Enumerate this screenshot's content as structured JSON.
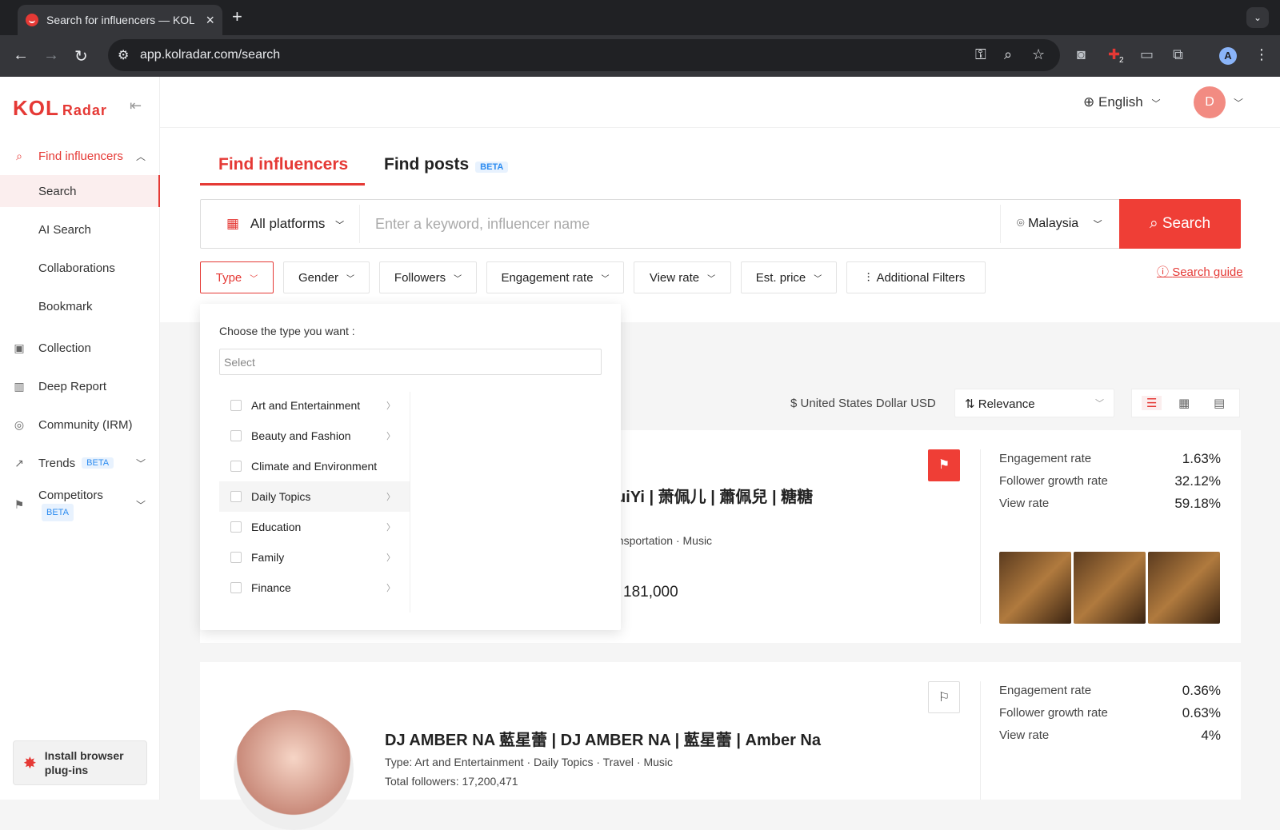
{
  "browser": {
    "tab_title": "Search for influencers — KOL Radar",
    "url": "app.kolradar.com/search",
    "extension_badge": "2",
    "profile_initial": "A"
  },
  "sidebar": {
    "logo_main": "KOL",
    "logo_sub": "Radar",
    "items": [
      {
        "label": "Find influencers"
      },
      {
        "label": "Search"
      },
      {
        "label": "AI Search"
      },
      {
        "label": "Collaborations"
      },
      {
        "label": "Bookmark"
      },
      {
        "label": "Collection"
      },
      {
        "label": "Deep Report"
      },
      {
        "label": "Community (IRM)"
      },
      {
        "label": "Trends",
        "badge": "BETA"
      },
      {
        "label": "Competitors",
        "badge": "BETA"
      }
    ],
    "plugin_label": "Install browser plug-ins"
  },
  "header": {
    "language": "English",
    "user_initial": "D"
  },
  "search": {
    "tab_influencers": "Find influencers",
    "tab_posts": "Find posts",
    "tab_posts_badge": "BETA",
    "platform": "All platforms",
    "placeholder": "Enter a keyword, influencer name",
    "country": "Malaysia",
    "button": "Search",
    "filters": [
      "Type",
      "Gender",
      "Followers",
      "Engagement rate",
      "View rate",
      "Est. price",
      "Additional Filters"
    ],
    "guide": "Search guide"
  },
  "results": {
    "currency": "United States Dollar USD",
    "sort": "Relevance",
    "cards": [
      {
        "name_fragment": "糖 | PuiYi | 萧佩儿 | 蕭佩兒 | 糖糖",
        "type_fragment": "ansportation · Music",
        "followers_fragment": "181,000",
        "metrics": [
          {
            "label": "Engagement rate",
            "value": "1.63%"
          },
          {
            "label": "Follower growth rate",
            "value": "32.12%"
          },
          {
            "label": "View rate",
            "value": "59.18%"
          }
        ]
      },
      {
        "name": "DJ AMBER NA 藍星蕾 | DJ AMBER NA | 藍星蕾 | Amber Na",
        "type_label": "Type:",
        "type_value": "Art and Entertainment · Daily Topics · Travel · Music",
        "followers_label": "Total followers:",
        "followers_value": "17,200,471",
        "metrics": [
          {
            "label": "Engagement rate",
            "value": "0.36%"
          },
          {
            "label": "Follower growth rate",
            "value": "0.63%"
          },
          {
            "label": "View rate",
            "value": "4%"
          }
        ]
      }
    ]
  },
  "type_dropdown": {
    "label": "Choose the type you want :",
    "placeholder": "Select",
    "options": [
      {
        "label": "Art and Entertainment"
      },
      {
        "label": "Beauty and Fashion"
      },
      {
        "label": "Climate and Environment"
      },
      {
        "label": "Daily Topics"
      },
      {
        "label": "Education"
      },
      {
        "label": "Family"
      },
      {
        "label": "Finance"
      }
    ]
  },
  "colors": {
    "accent": "#ef3e36",
    "beta": "#2d8cf0"
  }
}
